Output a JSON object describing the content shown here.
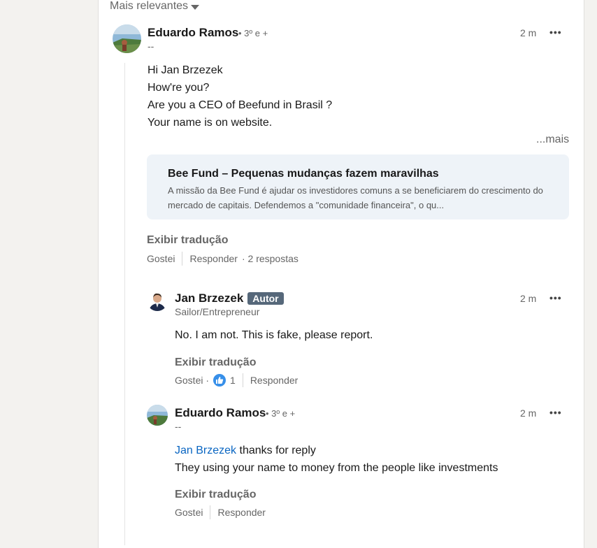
{
  "sort": {
    "label": "Mais relevantes"
  },
  "comment1": {
    "author": "Eduardo Ramos",
    "degree": "• 3º e +",
    "headline": "--",
    "time": "2 m",
    "lines": [
      "Hi Jan Brzezek",
      "How're you?",
      "Are you a CEO of Beefund in Brasil ?",
      "Your name is on website."
    ],
    "more": "...mais",
    "link_title": "Bee Fund – Pequenas mudanças fazem maravilhas",
    "link_desc": "A missão da Bee Fund é ajudar os investidores comuns a se beneficiarem do crescimento do mercado de capitais. Defendemos a \"comunidade financeira\", o qu...",
    "translate": "Exibir tradução",
    "like": "Gostei",
    "reply": "Responder",
    "replies": "· 2 respostas"
  },
  "reply1": {
    "author": "Jan Brzezek",
    "badge": "Autor",
    "headline": "Sailor/Entrepreneur",
    "time": "2 m",
    "text": "No. I am not. This is fake, please report.",
    "translate": "Exibir tradução",
    "like": "Gostei ·",
    "like_count": "1",
    "reply": "Responder"
  },
  "reply2": {
    "author": "Eduardo Ramos",
    "degree": "• 3º e +",
    "headline": "--",
    "time": "2 m",
    "mention": "Jan Brzezek",
    "text1": "thanks for reply",
    "text2": "They using your name to money from the people like investments",
    "translate": "Exibir tradução",
    "like": "Gostei",
    "reply": "Responder"
  },
  "colors": {
    "accent": "#0a66c2",
    "badge": "#56687a",
    "card": "#eef3f8",
    "like": "#378fe9"
  }
}
